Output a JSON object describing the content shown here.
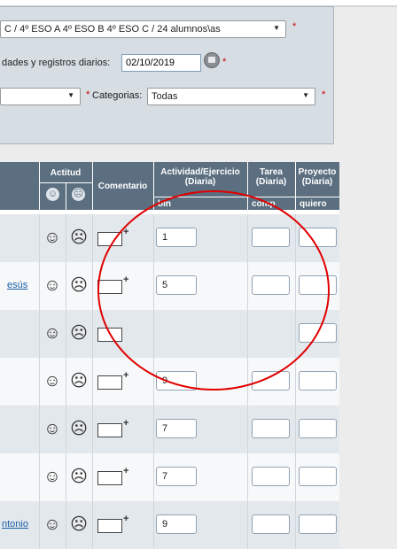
{
  "filters": {
    "group_select": "C / 4º ESO A 4º ESO B 4º ESO C / 24 alumnos\\as",
    "date_label": "dades y registros diarios:",
    "date_value": "02/10/2019",
    "category_label": "Categorias:",
    "category_value": "Todas",
    "required_mark": "*"
  },
  "table": {
    "headers": {
      "actitud": "Actitud",
      "comentario": "Comentario",
      "actividad": "Actividad/Ejercicio (Diaria)",
      "tarea": "Tarea (Diaria)",
      "proyecto": "Proyecto (Diaria)"
    },
    "subheaders": {
      "actividad": "bin",
      "tarea": "comp",
      "proyecto": "quiero"
    },
    "rows": [
      {
        "name": "",
        "actividad": "1",
        "tarea": "",
        "proyecto": ""
      },
      {
        "name": "esús",
        "actividad": "5",
        "tarea": "",
        "proyecto": ""
      },
      {
        "name": "",
        "actividad": "",
        "tarea": "",
        "proyecto": ""
      },
      {
        "name": "",
        "actividad": "9",
        "tarea": "",
        "proyecto": ""
      },
      {
        "name": "",
        "actividad": "7",
        "tarea": "",
        "proyecto": ""
      },
      {
        "name": "",
        "actividad": "7",
        "tarea": "",
        "proyecto": ""
      },
      {
        "name": "ntonio",
        "actividad": "9",
        "tarea": "",
        "proyecto": ""
      }
    ]
  },
  "icons": {
    "happy": "☺",
    "sad": "☹",
    "plus": "+",
    "arrow": "▼"
  },
  "colors": {
    "header_bg": "#5b6f80",
    "annotation": "#e00000",
    "required": "#cc0000",
    "link": "#1a5fa8"
  }
}
